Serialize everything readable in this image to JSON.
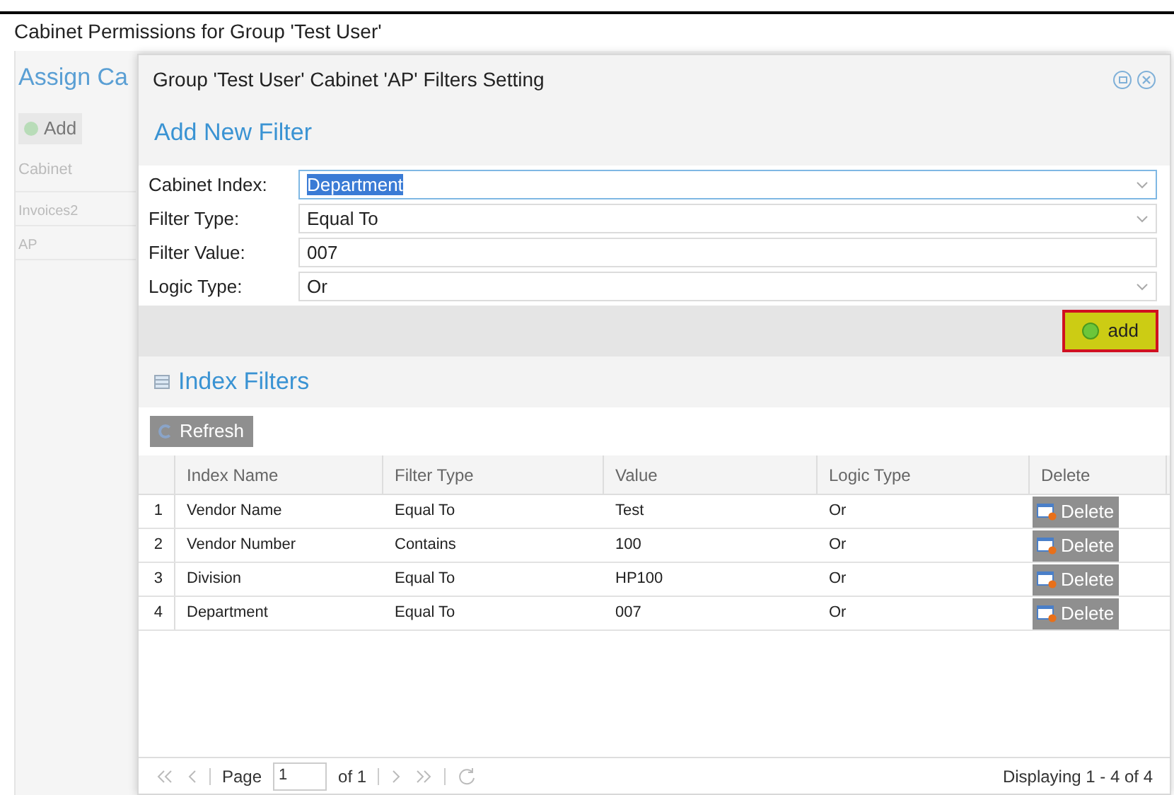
{
  "page_title": "Cabinet Permissions for Group 'Test User'",
  "background_panel": {
    "title": "Assign Ca",
    "add_button": "Add",
    "column": "Cabinet",
    "rows": [
      "Invoices2",
      "AP"
    ]
  },
  "dialog": {
    "title": "Group 'Test User' Cabinet 'AP' Filters Setting",
    "form_title": "Add New Filter",
    "fields": [
      {
        "label": "Cabinet Index:",
        "kind": "select",
        "value": "Department",
        "text_selected": true
      },
      {
        "label": "Filter Type:",
        "kind": "select",
        "value": "Equal To",
        "text_selected": false
      },
      {
        "label": "Filter Value:",
        "kind": "text",
        "value": "007",
        "text_selected": false
      },
      {
        "label": "Logic Type:",
        "kind": "select",
        "value": "Or",
        "text_selected": false
      }
    ],
    "add_button": {
      "label": "add",
      "highlighted": true
    },
    "grid_title": "Index Filters",
    "refresh_button": {
      "label": "Refresh",
      "disabled": true
    },
    "columns": [
      "Index Name",
      "Filter Type",
      "Value",
      "Logic Type",
      "Delete"
    ],
    "rows": [
      {
        "number": "1",
        "index_name": "Vendor Name",
        "filter_type": "Equal To",
        "value": "Test",
        "logic_type": "Or",
        "delete": "Delete",
        "disabled": true
      },
      {
        "number": "2",
        "index_name": "Vendor Number",
        "filter_type": "Contains",
        "value": "100",
        "logic_type": "Or",
        "delete": "Delete",
        "disabled": true
      },
      {
        "number": "3",
        "index_name": "Division",
        "filter_type": "Equal To",
        "value": "HP100",
        "logic_type": "Or",
        "delete": "Delete",
        "disabled": true
      },
      {
        "number": "4",
        "index_name": "Department",
        "filter_type": "Equal To",
        "value": "007",
        "logic_type": "Or",
        "delete": "Delete",
        "disabled": true
      }
    ],
    "paging": {
      "page_label": "Page",
      "page": "1",
      "of": "of 1",
      "display": "Displaying 1 - 4 of 4"
    }
  }
}
